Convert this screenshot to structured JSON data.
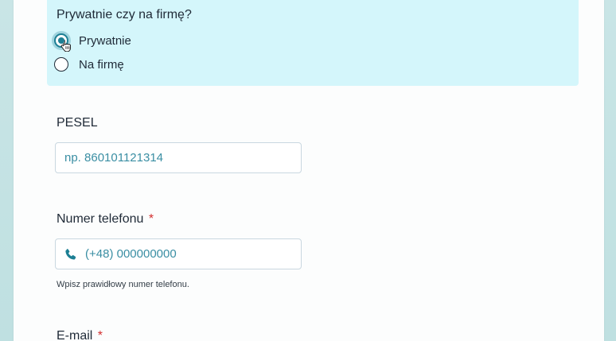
{
  "customer_type": {
    "title": "Prywatnie czy na firmę?",
    "options": [
      {
        "label": "Prywatnie",
        "selected": true
      },
      {
        "label": "Na firmę",
        "selected": false
      }
    ]
  },
  "pesel": {
    "label": "PESEL",
    "placeholder": "np. 860101121314",
    "value": ""
  },
  "phone": {
    "label": "Numer telefonu",
    "required_marker": "*",
    "placeholder": "(+48) 000000000",
    "value": "",
    "icon": "phone-icon",
    "hint": "Wpisz prawidłowy numer telefonu."
  },
  "email": {
    "label": "E-mail",
    "required_marker": "*"
  },
  "colors": {
    "accent": "#1d7f94",
    "highlight_bg": "#d4f6fb",
    "required": "#d32f2f",
    "placeholder": "#3a8ea3"
  }
}
